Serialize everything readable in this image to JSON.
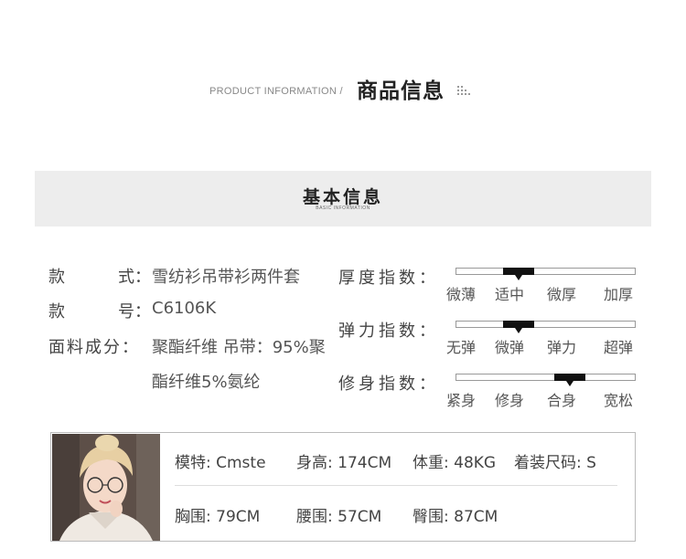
{
  "header": {
    "en": "PRODUCT INFORMATION /",
    "cn": "商品信息"
  },
  "basic": {
    "title": "基本信息",
    "subtitle": "BASIC INFORMATION"
  },
  "info": {
    "style_label_a": "款",
    "style_label_b": "式：",
    "style_value": "雪纺衫吊带衫两件套",
    "code_label_a": "款",
    "code_label_b": "号：",
    "code_value": "C6106K",
    "fabric_label": "面料成分：",
    "fabric_value_1": "聚酯纤维 吊带：95%聚",
    "fabric_value_2": "酯纤维5%氨纶"
  },
  "indices": [
    {
      "label": "厚度指数：",
      "options": [
        "微薄",
        "适中",
        "微厚",
        "加厚"
      ],
      "selected": 1
    },
    {
      "label": "弹力指数：",
      "options": [
        "无弹",
        "微弹",
        "弹力",
        "超弹"
      ],
      "selected": 1
    },
    {
      "label": "修身指数：",
      "options": [
        "紧身",
        "修身",
        "合身",
        "宽松"
      ],
      "selected": 2
    }
  ],
  "model": {
    "name": "模特: Cmste",
    "height": "身高: 174CM",
    "weight": "体重: 48KG",
    "size": "着装尺码: S",
    "bust": "胸围: 79CM",
    "waist": "腰围: 57CM",
    "hip": "臀围: 87CM"
  },
  "colors": {
    "band": "#ededed",
    "slider_fill": "#111111"
  }
}
